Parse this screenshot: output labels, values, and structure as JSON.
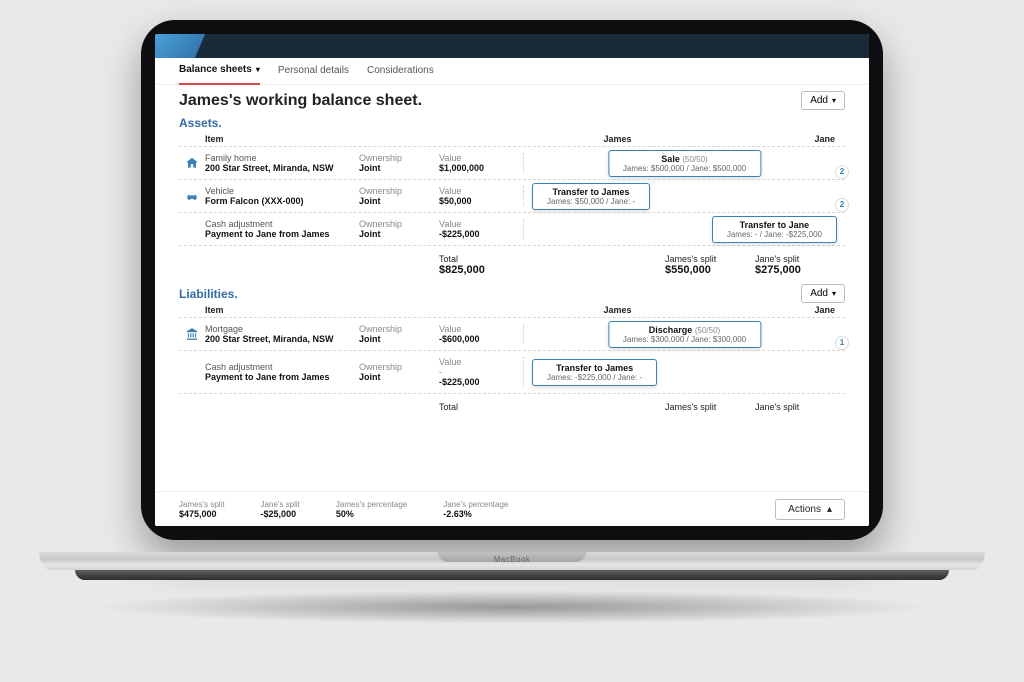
{
  "topbar": {
    "brand": "MacBook"
  },
  "tabs": {
    "balance_sheets": "Balance sheets",
    "personal_details": "Personal details",
    "considerations": "Considerations"
  },
  "page_title": "James's working balance sheet.",
  "add_label": "Add",
  "assets_label": "Assets.",
  "liabilities_label": "Liabilities.",
  "col_item": "Item",
  "col_james": "James",
  "col_jane": "Jane",
  "ownership_label": "Ownership",
  "value_label": "Value",
  "total_label": "Total",
  "james_split_label": "James's split",
  "jane_split_label": "Jane's split",
  "assets": {
    "rows": [
      {
        "icon": "home",
        "title": "Family home",
        "subtitle": "200 Star Street, Miranda, NSW",
        "ownership": "Joint",
        "value": "$1,000,000",
        "action": {
          "pos": "center",
          "title": "Sale",
          "suffix": "(50/50)",
          "detail": "James: $500,000 / Jane: $500,000"
        },
        "badge": "2"
      },
      {
        "icon": "car",
        "title": "Vehicle",
        "subtitle": "Form Falcon (XXX-000)",
        "ownership": "Joint",
        "value": "$50,000",
        "action": {
          "pos": "left",
          "title": "Transfer to James",
          "detail": "James: $50,000 / Jane: -"
        },
        "badge": "2"
      },
      {
        "icon": "",
        "title": "Cash adjustment",
        "subtitle": "Payment to Jane from James",
        "ownership": "Joint",
        "value": "-$225,000",
        "action": {
          "pos": "right",
          "title": "Transfer to Jane",
          "detail": "James: - / Jane: -$225,000"
        }
      }
    ],
    "total": "$825,000",
    "james_split": "$550,000",
    "jane_split": "$275,000"
  },
  "liabilities": {
    "rows": [
      {
        "icon": "bank",
        "title": "Mortgage",
        "subtitle": "200 Star Street, Miranda, NSW",
        "ownership": "Joint",
        "value": "-$600,000",
        "action": {
          "pos": "center",
          "title": "Discharge",
          "suffix": "(50/50)",
          "detail": "James: $300,000 / Jane: $300,000"
        },
        "badge": "1"
      },
      {
        "icon": "",
        "title": "Cash adjustment",
        "subtitle": "Payment to Jane from James",
        "ownership": "Joint",
        "value_prefix": "-",
        "value": "-$225,000",
        "action": {
          "pos": "left",
          "title": "Transfer to James",
          "detail": "James: -$225,000 / Jane: -"
        }
      }
    ]
  },
  "footer": {
    "james_split_label": "James's split",
    "james_split_value": "$475,000",
    "jane_split_label": "Jane's split",
    "jane_split_value": "-$25,000",
    "james_pct_label": "James's percentage",
    "james_pct_value": "50%",
    "jane_pct_label": "Jane's percentage",
    "jane_pct_value": "-2.63%",
    "actions_label": "Actions"
  }
}
